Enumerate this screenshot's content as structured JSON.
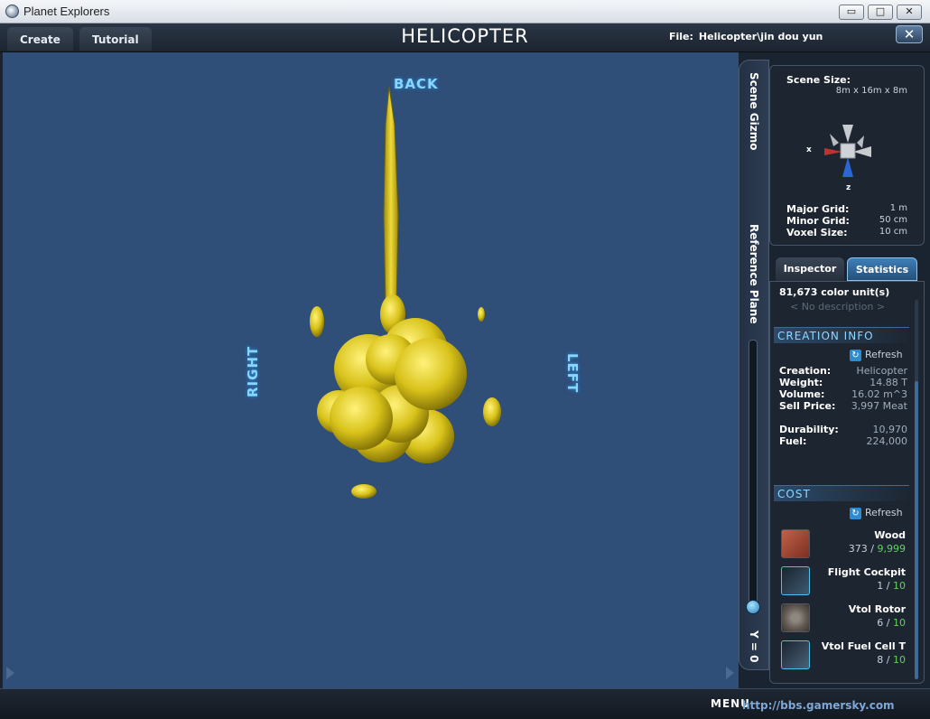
{
  "window": {
    "title": "Planet Explorers",
    "minimize": "▭",
    "maximize": "□",
    "close": "✕"
  },
  "toolbar": {
    "create_label": "Create",
    "tutorial_label": "Tutorial",
    "title": "HELICOPTER",
    "file_label": "File:",
    "file_value": "Helicopter\\jin dou yun",
    "close_label": "✕"
  },
  "viewport": {
    "back_label": "BACK",
    "right_label": "RIGHT",
    "left_label": "LEFT",
    "model_color": "#d8c21a"
  },
  "sidestrip": {
    "scene_gizmo": "Scene Gizmo",
    "reference_plane": "Reference Plane",
    "y_value": "Y = 0"
  },
  "gizmo": {
    "scene_size_label": "Scene Size:",
    "scene_size_value": "8m x 16m x 8m",
    "axis_x": "x",
    "axis_z": "z",
    "major_grid_label": "Major Grid:",
    "major_grid_value": "1 m",
    "minor_grid_label": "Minor Grid:",
    "minor_grid_value": "50 cm",
    "voxel_size_label": "Voxel Size:",
    "voxel_size_value": "10 cm"
  },
  "tabs": {
    "inspector": "Inspector",
    "statistics": "Statistics"
  },
  "stats": {
    "color_units": "81,673 color unit(s)",
    "description_placeholder": "< No description >",
    "creation_info_header": "CREATION INFO",
    "refresh_label": "Refresh",
    "rows": [
      {
        "label": "Creation:",
        "value": "Helicopter"
      },
      {
        "label": "Weight:",
        "value": "14.88 T"
      },
      {
        "label": "Volume:",
        "value": "16.02 m^3"
      },
      {
        "label": "Sell Price:",
        "value": "3,997 Meat"
      },
      {
        "label": "Durability:",
        "value": "10,970"
      },
      {
        "label": "Fuel:",
        "value": "224,000"
      }
    ],
    "cost_header": "COST",
    "cost_items": [
      {
        "name": "Wood",
        "used": "373",
        "sep": " / ",
        "have": "9,999"
      },
      {
        "name": "Flight Cockpit",
        "used": "1",
        "sep": " / ",
        "have": "10"
      },
      {
        "name": "Vtol Rotor",
        "used": "6",
        "sep": " / ",
        "have": "10"
      },
      {
        "name": "Vtol Fuel Cell T",
        "used": "8",
        "sep": " / ",
        "have": "10"
      }
    ]
  },
  "bottom": {
    "menu_label": "MENU",
    "watermark": "http://bbs.gamersky.com"
  }
}
